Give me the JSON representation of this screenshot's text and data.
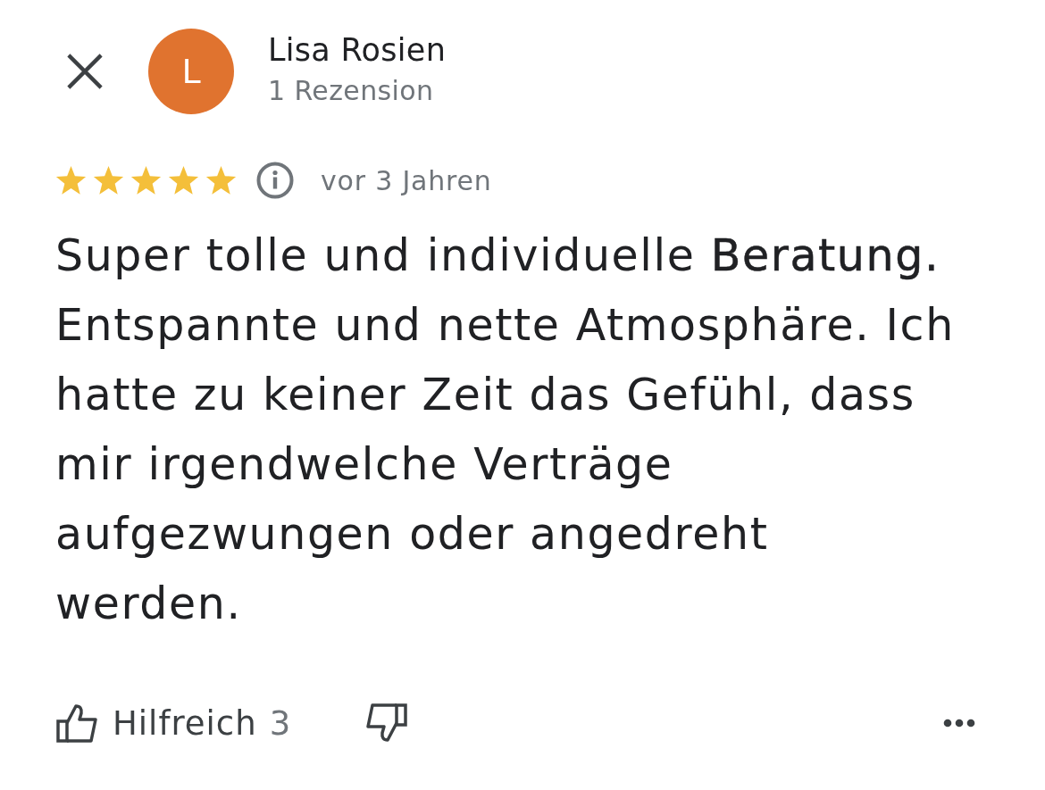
{
  "reviewer": {
    "initial": "L",
    "name": "Lisa Rosien",
    "review_count": "1 Rezension"
  },
  "rating": {
    "stars": 5,
    "time": "vor 3 Jahren"
  },
  "review_text": "Super tolle und individuelle **Beratung.** Entspannte und nette Atmosphäre. Ich hatte zu keiner Zeit das Gefühl, dass mir irgendwelche Verträge aufgezwungen oder angedreht werden.",
  "actions": {
    "helpful_label": "Hilfreich",
    "helpful_count": "3"
  }
}
